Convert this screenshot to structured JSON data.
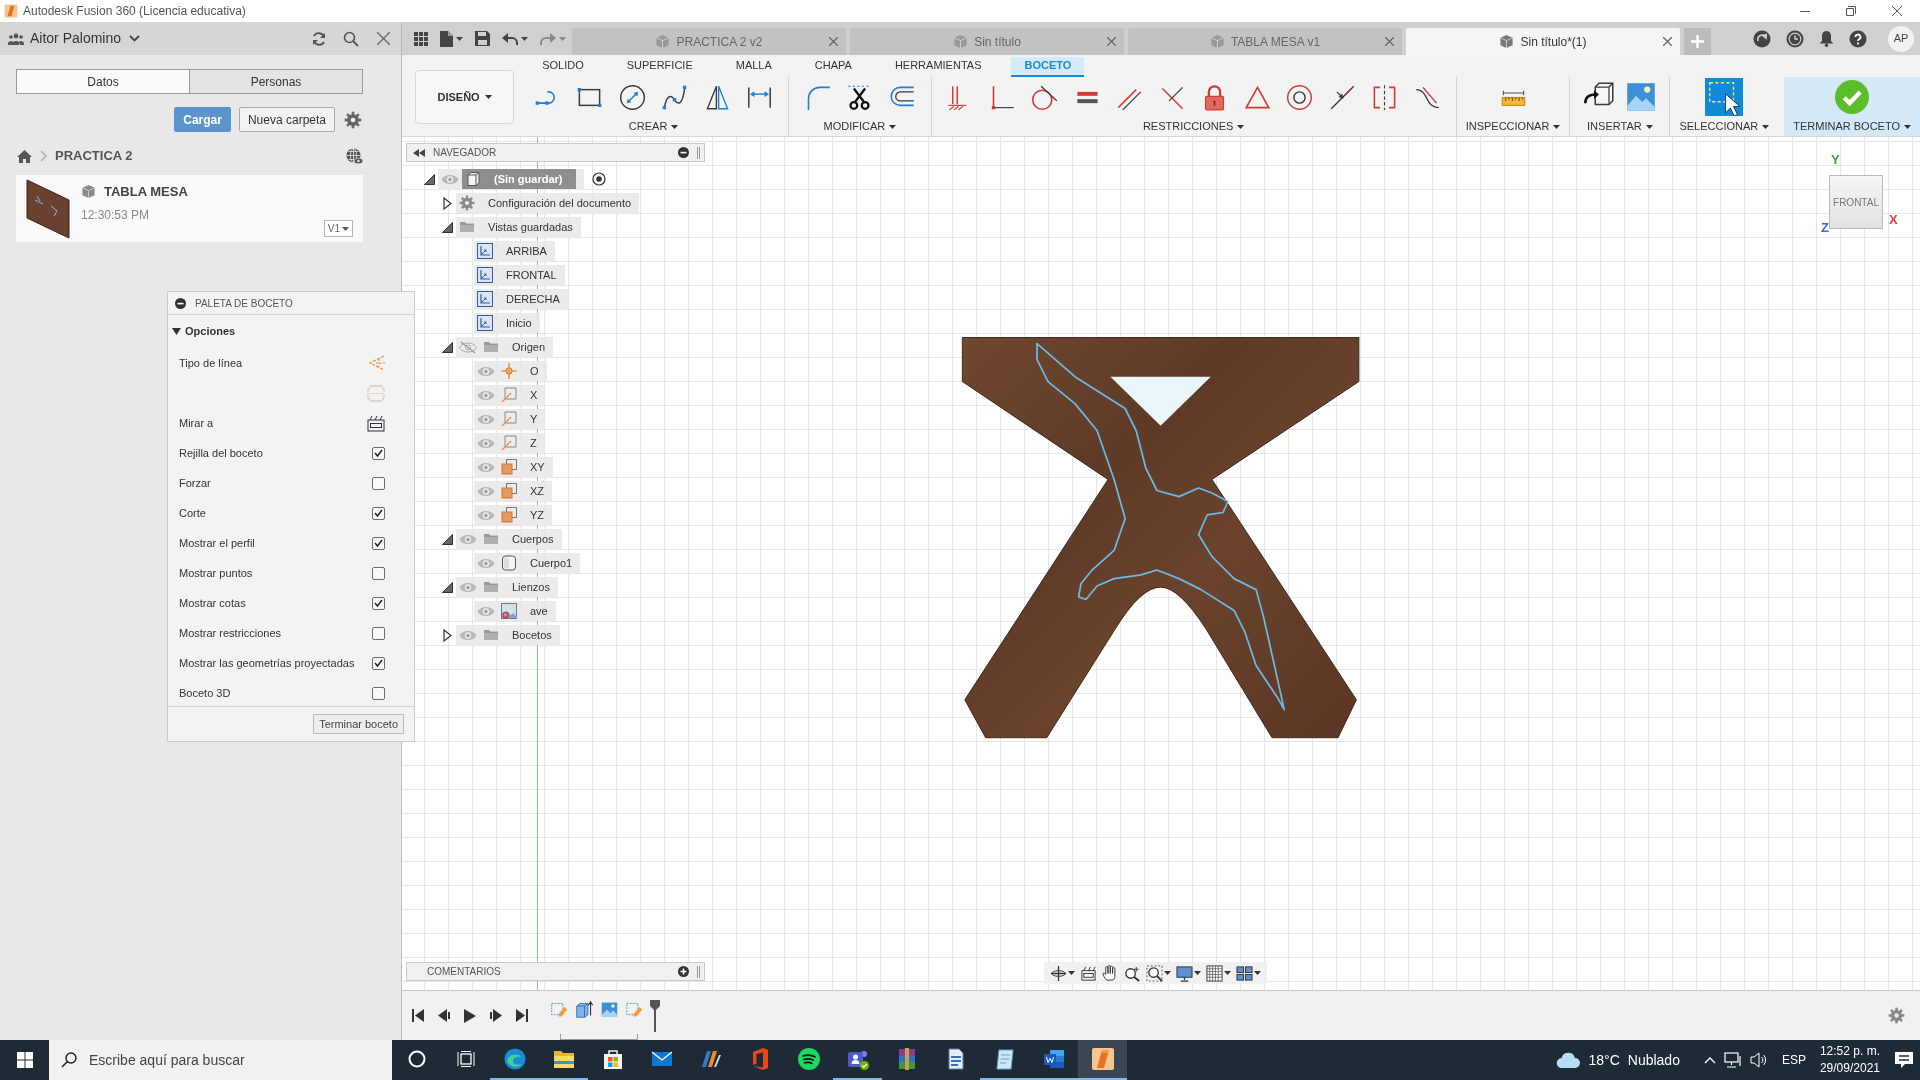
{
  "window": {
    "title": "Autodesk Fusion 360 (Licencia educativa)"
  },
  "data_panel": {
    "user": "Aitor Palomino",
    "tabs": [
      {
        "label": "Datos",
        "selected": true
      },
      {
        "label": "Personas",
        "selected": false
      }
    ],
    "buttons": [
      {
        "label": "Cargar",
        "kind": "primary"
      },
      {
        "label": "Nueva carpeta",
        "kind": "secondary"
      }
    ],
    "breadcrumb": "PRACTICA 2",
    "files": [
      {
        "name": "TABLA MESA",
        "time": "12:30:53 PM",
        "version": "V1"
      }
    ]
  },
  "document_tabs": [
    {
      "label": "PRACTICA 2 v2",
      "selected": false
    },
    {
      "label": "Sin título",
      "selected": false
    },
    {
      "label": "TABLA MESA v1",
      "selected": false
    },
    {
      "label": "Sin título*(1)",
      "selected": true
    }
  ],
  "account": {
    "initials": "AP"
  },
  "toolbar": {
    "workspace": "DISEÑO",
    "tabs": [
      {
        "label": "SOLIDO",
        "selected": false
      },
      {
        "label": "SUPERFICIE",
        "selected": false
      },
      {
        "label": "MALLA",
        "selected": false
      },
      {
        "label": "CHAPA",
        "selected": false
      },
      {
        "label": "HERRAMIENTAS",
        "selected": false
      },
      {
        "label": "BOCETO",
        "selected": true
      }
    ],
    "groups": [
      {
        "label": "CREAR",
        "kind": "create"
      },
      {
        "label": "MODIFICAR",
        "kind": "modify"
      },
      {
        "label": "RESTRICCIONES",
        "kind": "constraints"
      },
      {
        "label": "INSPECCIONAR",
        "kind": "inspect"
      },
      {
        "label": "INSERTAR",
        "kind": "insert"
      },
      {
        "label": "SELECCIONAR",
        "kind": "select"
      },
      {
        "label": "TERMINAR BOCETO",
        "kind": "finish"
      }
    ]
  },
  "browser": {
    "title": "NAVEGADOR",
    "items": [
      {
        "label": "(Sin guardar)",
        "kind": "component",
        "visible": true,
        "expanded": true,
        "active": true,
        "children": [
          {
            "label": "Configuración del documento",
            "kind": "settings",
            "expanded": false
          },
          {
            "label": "Vistas guardadas",
            "kind": "folder",
            "expanded": true,
            "children": [
              {
                "label": "ARRIBA",
                "kind": "view"
              },
              {
                "label": "FRONTAL",
                "kind": "view"
              },
              {
                "label": "DERECHA",
                "kind": "view"
              },
              {
                "label": "Inicio",
                "kind": "view"
              }
            ]
          },
          {
            "label": "Origen",
            "kind": "folder",
            "visible": false,
            "expanded": true,
            "children": [
              {
                "label": "O",
                "kind": "point",
                "visible": true
              },
              {
                "label": "X",
                "kind": "axis",
                "visible": true
              },
              {
                "label": "Y",
                "kind": "axis",
                "visible": true
              },
              {
                "label": "Z",
                "kind": "axis",
                "visible": true
              },
              {
                "label": "XY",
                "kind": "plane",
                "visible": true
              },
              {
                "label": "XZ",
                "kind": "plane",
                "visible": true
              },
              {
                "label": "YZ",
                "kind": "plane",
                "visible": true
              }
            ]
          },
          {
            "label": "Cuerpos",
            "kind": "folder",
            "visible": true,
            "expanded": true,
            "children": [
              {
                "label": "Cuerpo1",
                "kind": "body",
                "visible": true
              }
            ]
          },
          {
            "label": "Lienzos",
            "kind": "folder",
            "visible": true,
            "expanded": true,
            "children": [
              {
                "label": "ave",
                "kind": "canvas",
                "visible": true
              }
            ]
          },
          {
            "label": "Bocetos",
            "kind": "folder",
            "visible": true,
            "expanded": false
          }
        ]
      }
    ]
  },
  "sketch_palette": {
    "title": "PALETA DE BOCETO",
    "section": {
      "label": "Opciones",
      "expanded": true
    },
    "options": [
      {
        "label": "Tipo de línea",
        "kind": "construction"
      },
      {
        "kind": "centerline"
      },
      {
        "label": "Mirar a",
        "kind": "lookat"
      },
      {
        "label": "Rejilla del boceto",
        "kind": "checkbox",
        "checked": true
      },
      {
        "label": "Forzar",
        "kind": "checkbox",
        "checked": false
      },
      {
        "label": "Corte",
        "kind": "checkbox",
        "checked": true
      },
      {
        "label": "Mostrar el perfil",
        "kind": "checkbox",
        "checked": true
      },
      {
        "label": "Mostrar puntos",
        "kind": "checkbox",
        "checked": false
      },
      {
        "label": "Mostrar cotas",
        "kind": "checkbox",
        "checked": true
      },
      {
        "label": "Mostrar restricciones",
        "kind": "checkbox",
        "checked": false
      },
      {
        "label": "Mostrar las geometrías proyectadas",
        "kind": "checkbox",
        "checked": true
      },
      {
        "label": "Boceto 3D",
        "kind": "checkbox",
        "checked": false
      }
    ],
    "button": "Terminar boceto"
  },
  "view_cube": {
    "face": "FRONTAL",
    "axes": [
      {
        "label": "Y",
        "color": "#3fa33f"
      },
      {
        "label": "X",
        "color": "#e0413a"
      },
      {
        "label": "Z",
        "color": "#3f66d4"
      }
    ]
  },
  "comments": {
    "title": "COMENTARIOS"
  },
  "timeline": {
    "features": [
      {
        "kind": "sketch"
      },
      {
        "kind": "extrude"
      },
      {
        "kind": "canvas"
      },
      {
        "kind": "sketch"
      }
    ]
  },
  "taskbar": {
    "search": {
      "placeholder": "Escribe aquí para buscar"
    },
    "apps": [
      {
        "kind": "browser",
        "running": true,
        "selected": false
      },
      {
        "kind": "files",
        "running": true,
        "selected": false
      },
      {
        "kind": "store",
        "running": false,
        "selected": false
      },
      {
        "kind": "mail",
        "running": false,
        "selected": false
      },
      {
        "kind": "video",
        "running": false,
        "selected": false
      },
      {
        "kind": "office",
        "running": false,
        "selected": false
      },
      {
        "kind": "music",
        "running": false,
        "selected": false
      },
      {
        "kind": "chat",
        "running": true,
        "selected": false
      },
      {
        "kind": "archive",
        "running": false,
        "selected": false
      },
      {
        "kind": "page",
        "running": false,
        "selected": false
      },
      {
        "kind": "notes",
        "running": true,
        "selected": false
      },
      {
        "kind": "word",
        "running": true,
        "selected": false
      },
      {
        "kind": "cad",
        "running": true,
        "selected": true
      }
    ],
    "weather": {
      "temperature": "18°C",
      "condition": "Nublado"
    },
    "language": "ESP",
    "time": "12:52 p. m.",
    "date": "29/09/2021"
  }
}
